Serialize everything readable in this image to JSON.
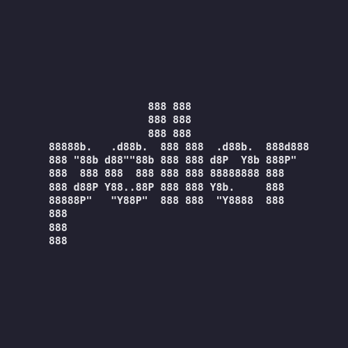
{
  "ascii_art": {
    "lines": [
      "                888 888",
      "                888 888",
      "                888 888",
      "88888b.   .d88b.  888 888  .d88b.  888d888",
      "888 \"88b d88\"\"88b 888 888 d8P  Y8b 888P\"",
      "888  888 888  888 888 888 88888888 888",
      "888 d88P Y88..88P 888 888 Y8b.     888",
      "88888P\"   \"Y88P\"  888 888  \"Y8888  888",
      "888",
      "888",
      "888"
    ]
  },
  "colors": {
    "background": "#22212f",
    "text": "#e6e6ea"
  }
}
